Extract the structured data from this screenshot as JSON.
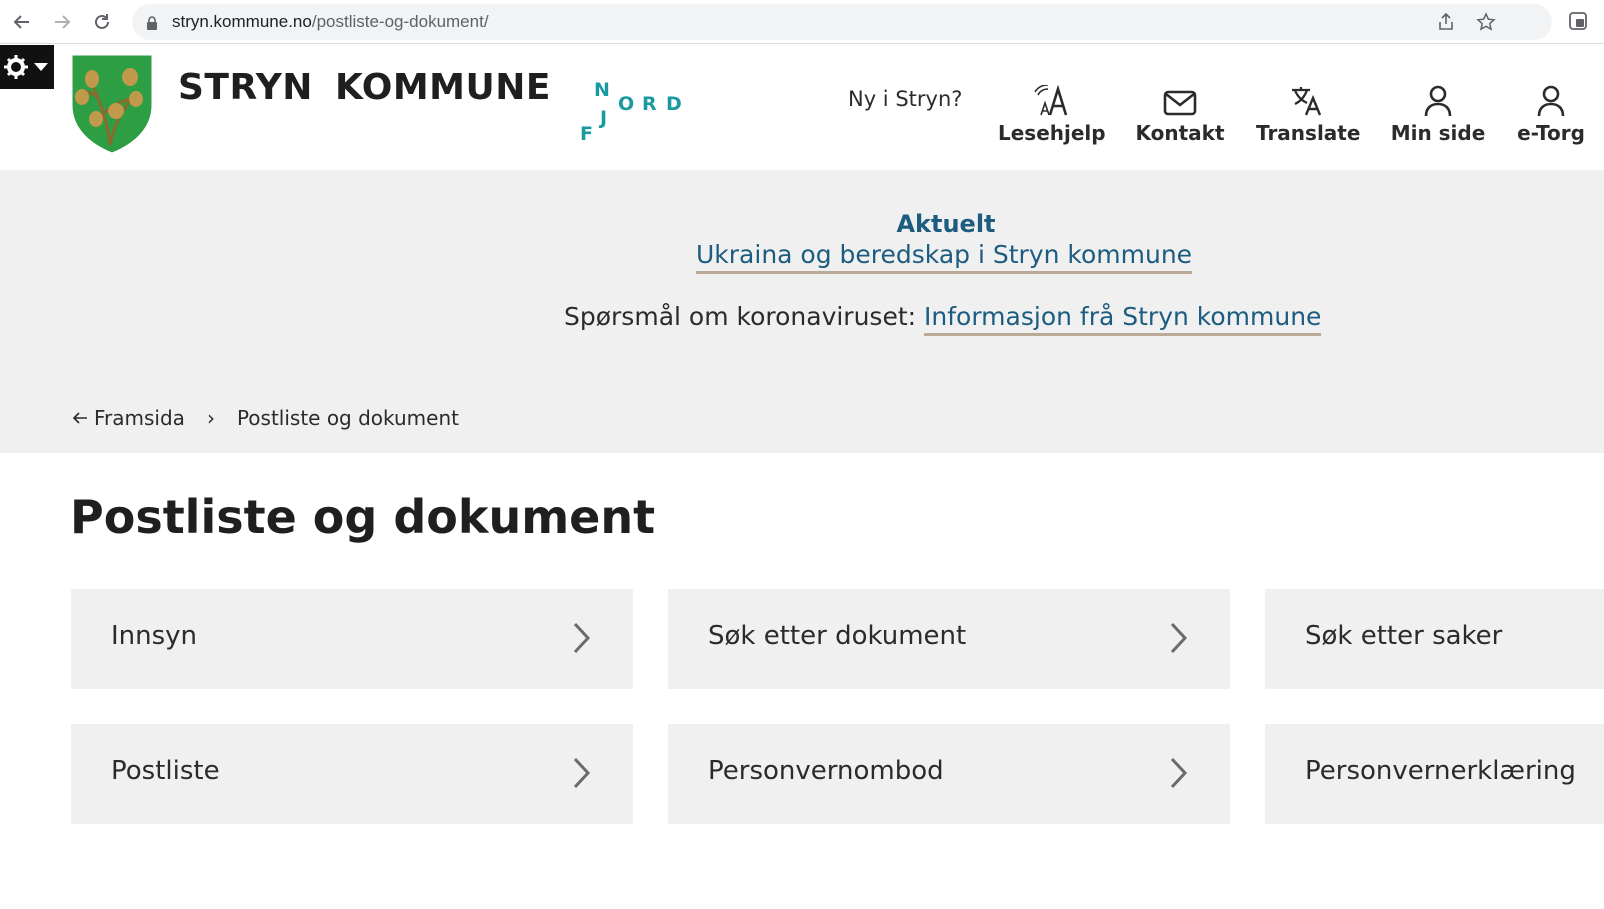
{
  "browser": {
    "url_host": "stryn.kommune.no",
    "url_path": "/postliste-og-dokument/",
    "icons": [
      "back-icon",
      "forward-icon",
      "reload-icon",
      "lock-icon",
      "share-icon",
      "star-icon",
      "extension-icon"
    ]
  },
  "header": {
    "brand_word1": "STRYN",
    "brand_word2": "KOMMUNE",
    "nordfjord": {
      "n": "N",
      "o": "O",
      "r": "R",
      "d": "D",
      "j": "J",
      "f": "F"
    },
    "new_link": "Ny i Stryn?",
    "tools": [
      {
        "label": "Lesehjelp",
        "icon": "reading-aid-icon"
      },
      {
        "label": "Kontakt",
        "icon": "mail-icon"
      },
      {
        "label": "Translate",
        "icon": "translate-icon"
      },
      {
        "label": "Min side",
        "icon": "user-icon"
      },
      {
        "label": "e-Torg",
        "icon": "user-icon"
      }
    ]
  },
  "banner": {
    "news_title": "Aktuelt",
    "news_link": "Ukraina og beredskap i Stryn kommune",
    "corona_text": "Spørsmål om koronaviruset: ",
    "corona_link": "Informasjon frå Stryn kommune"
  },
  "breadcrumb": {
    "back_label": "Framsida",
    "current": "Postliste og dokument"
  },
  "main": {
    "title": "Postliste og dokument",
    "cards": [
      {
        "label": "Innsyn"
      },
      {
        "label": "Søk etter dokument"
      },
      {
        "label": "Søk etter saker"
      },
      {
        "label": "Postliste"
      },
      {
        "label": "Personvernombod"
      },
      {
        "label": "Personvernerklæring"
      }
    ]
  },
  "colors": {
    "link": "#1c5c80",
    "underline": "#b9aa98",
    "banner_bg": "#f0f0f0",
    "card_bg": "#f0f0f0",
    "nordfjord": "#1a9aa0",
    "crest_green": "#2e9e44",
    "crest_gold": "#c0994a"
  }
}
